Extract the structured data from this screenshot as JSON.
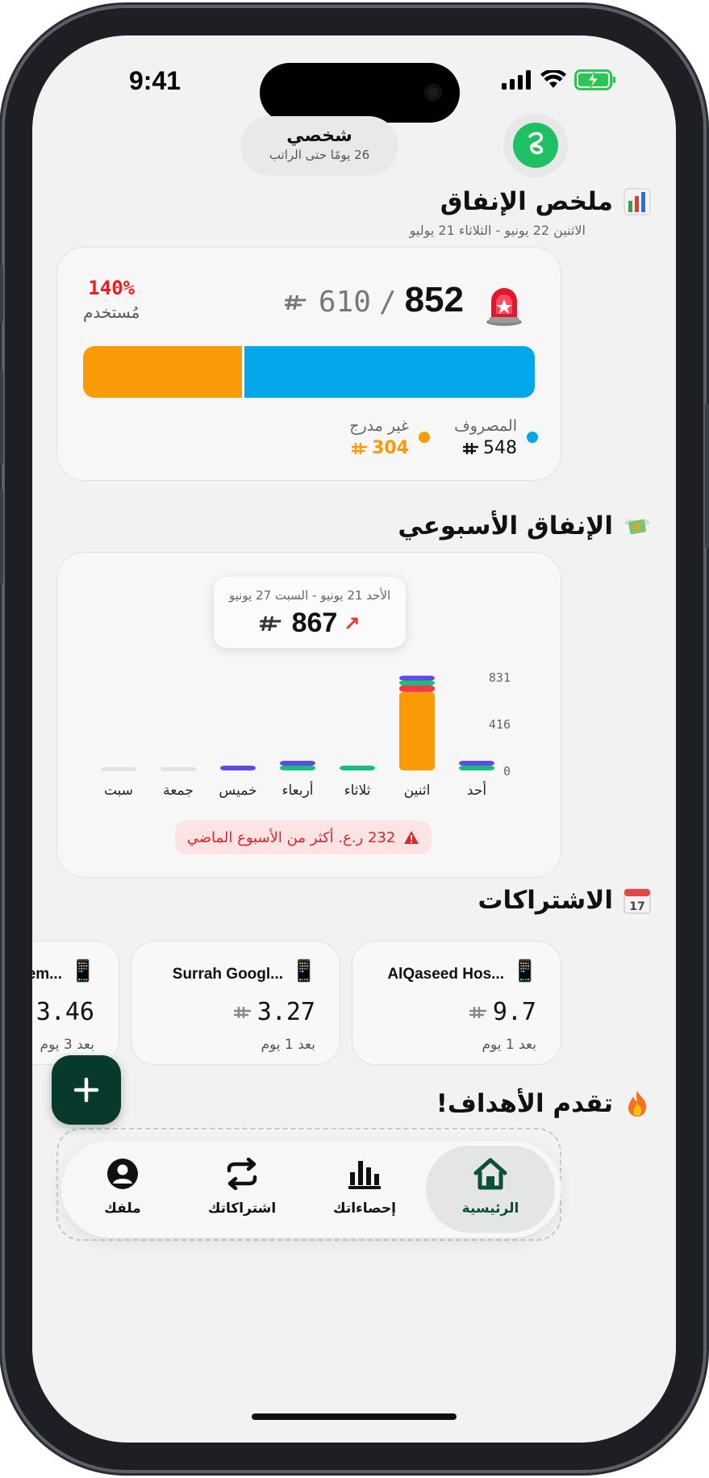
{
  "status_bar": {
    "time": "9:41"
  },
  "header": {
    "profile_name": "شخصي",
    "profile_sub": "26 يومًا حتى الراتب"
  },
  "summary": {
    "title": "ملخص الإنفاق",
    "date_range": "الاثنين 22 يونيو - الثلاثاء 21 يوليو",
    "spent_total": "852",
    "separator": "/",
    "budget": "610",
    "percent_used": "140%",
    "percent_label": "مُستخدم",
    "progress": {
      "spent_fraction": 0.643,
      "uncategorized_fraction": 0.357
    },
    "legend_spent_label": "المصروف",
    "legend_spent_value": "548",
    "legend_uncat_label": "غير مدرج",
    "legend_uncat_value": "304",
    "colors": {
      "spent": "#04a7ea",
      "uncategorized": "#fb9a07",
      "over": "#e52020"
    }
  },
  "weekly": {
    "title": "الإنفاق الأسبوعي",
    "tooltip_range": "الأحد 21 يونيو - السبت 27 يونيو",
    "tooltip_total": "867",
    "alert_text": "232 ر.ع. أكثر من الأسبوع الماضي"
  },
  "chart_data": {
    "type": "bar",
    "stacked": true,
    "categories": [
      "أحد",
      "اثنين",
      "ثلاثاء",
      "أربعاء",
      "خميس",
      "جمعة",
      "سبت"
    ],
    "y_ticks": [
      0,
      416,
      831
    ],
    "ylim": [
      0,
      831
    ],
    "series": [
      {
        "color": "#fb9a07",
        "values": [
          0,
          698,
          0,
          0,
          0,
          0,
          0
        ]
      },
      {
        "color": "#f4384a",
        "values": [
          0,
          58,
          0,
          0,
          0,
          0,
          0
        ]
      },
      {
        "color": "#16c07a",
        "values": [
          20,
          30,
          40,
          25,
          0,
          0,
          0
        ]
      },
      {
        "color": "#5a4ee6",
        "values": [
          18,
          40,
          0,
          20,
          42,
          0,
          0
        ]
      }
    ]
  },
  "subscriptions": {
    "title": "الاشتراكات",
    "items": [
      {
        "name": "AlQaseed Hos...",
        "price": "9.7",
        "due": "بعد 1 يوم"
      },
      {
        "name": "Surrah Googl...",
        "price": "3.27",
        "due": "بعد 1 يوم"
      },
      {
        "name": "em...",
        "price": "3.46",
        "due": "بعد 3 يوم"
      }
    ]
  },
  "goals": {
    "title": "تقدم الأهداف!"
  },
  "nav": {
    "home": "الرئيسية",
    "stats": "إحصاءاتك",
    "subs": "اشتراكاتك",
    "profile": "ملفك"
  }
}
